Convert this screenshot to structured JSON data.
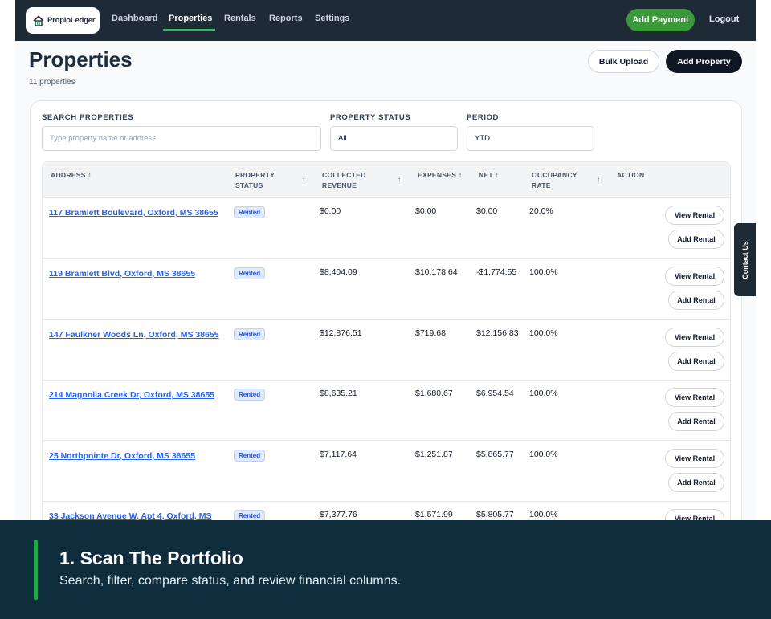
{
  "app": {
    "name": "PropioLedger"
  },
  "nav": {
    "items": [
      {
        "label": "Dashboard"
      },
      {
        "label": "Properties"
      },
      {
        "label": "Rentals"
      },
      {
        "label": "Reports"
      },
      {
        "label": "Settings"
      }
    ],
    "active": "Properties",
    "add_payment_label": "Add Payment",
    "logout_label": "Logout"
  },
  "header": {
    "title": "Properties",
    "count_text": "11 properties",
    "bulk_upload_label": "Bulk Upload",
    "add_property_label": "Add Property"
  },
  "filters": {
    "search_label": "SEARCH PROPERTIES",
    "search_placeholder": "Type property name or address",
    "status_label": "PROPERTY STATUS",
    "status_value": "All",
    "period_label": "PERIOD",
    "period_value": "YTD"
  },
  "table": {
    "columns": {
      "address": "ADDRESS",
      "status_1": "PROPERTY",
      "status_2": "STATUS",
      "revenue_1": "COLLECTED",
      "revenue_2": "REVENUE",
      "expenses": "EXPENSES",
      "net": "NET",
      "occupancy_1": "OCCUPANCY",
      "occupancy_2": "RATE",
      "action": "ACTION"
    },
    "view_label": "View Rental",
    "add_label": "Add Rental",
    "rows": [
      {
        "address": "117 Bramlett Boulevard, Oxford, MS 38655",
        "status": "Rented",
        "revenue": "$0.00",
        "expenses": "$0.00",
        "net": "$0.00",
        "occupancy": "20.0%"
      },
      {
        "address": "119 Bramlett Blvd, Oxford, MS 38655",
        "status": "Rented",
        "revenue": "$8,404.09",
        "expenses": "$10,178.64",
        "net": "-$1,774.55",
        "occupancy": "100.0%"
      },
      {
        "address": "147 Faulkner Woods Ln, Oxford, MS 38655",
        "status": "Rented",
        "revenue": "$12,876.51",
        "expenses": "$719.68",
        "net": "$12,156.83",
        "occupancy": "100.0%"
      },
      {
        "address": "214 Magnolia Creek Dr, Oxford, MS 38655",
        "status": "Rented",
        "revenue": "$8,635.21",
        "expenses": "$1,680.67",
        "net": "$6,954.54",
        "occupancy": "100.0%"
      },
      {
        "address": "25 Northpointe Dr, Oxford, MS 38655",
        "status": "Rented",
        "revenue": "$7,117.64",
        "expenses": "$1,251.87",
        "net": "$5,865.77",
        "occupancy": "100.0%"
      },
      {
        "address": "33 Jackson Avenue W, Apt 4, Oxford, MS",
        "status": "Rented",
        "revenue": "$7,377.76",
        "expenses": "$1,571.99",
        "net": "$5,805.77",
        "occupancy": "100.0%"
      }
    ]
  },
  "contact_tab": "Contact Us",
  "caption": {
    "title": "1. Scan The Portfolio",
    "subtitle": "Search, filter, compare status, and review financial columns."
  },
  "colors": {
    "nav_bg": "#1f2a37",
    "accent_green": "#3a9a3a",
    "link_blue": "#2563eb",
    "banner_bg": "#0f2d3d",
    "banner_bar": "#22a84a"
  }
}
